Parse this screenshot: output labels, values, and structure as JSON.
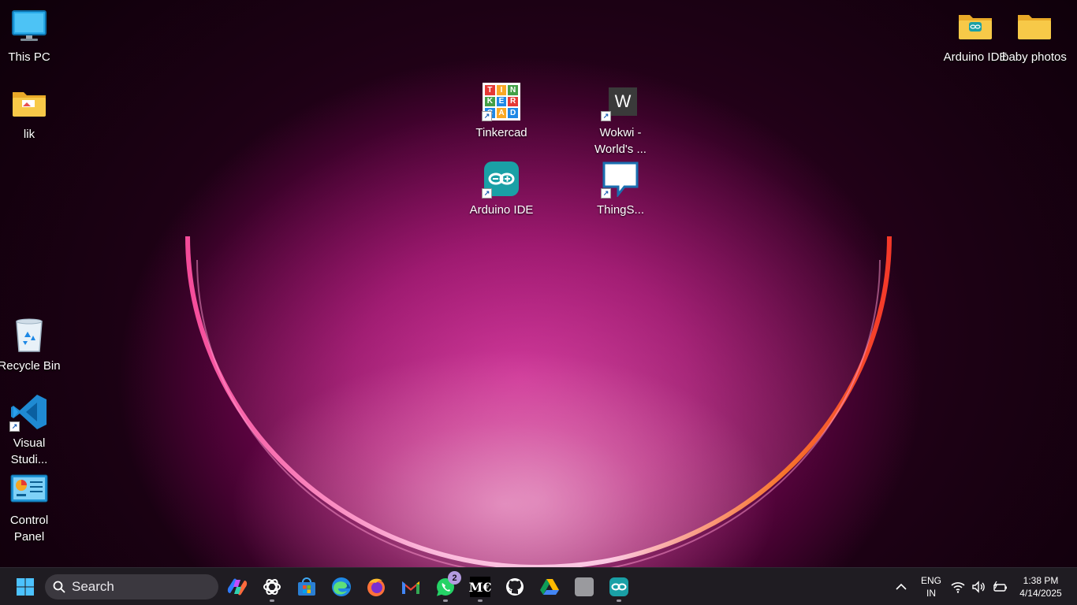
{
  "desktop": {
    "left_icons": [
      {
        "label": "This PC"
      },
      {
        "label": "lik"
      },
      {
        "label": "Recycle Bin"
      },
      {
        "label": "Visual Studi..."
      },
      {
        "label": "Control Panel"
      }
    ],
    "center_icons": [
      {
        "label": "Tinkercad",
        "tile": [
          "T",
          "I",
          "N",
          "K",
          "E",
          "R",
          "C",
          "A",
          "D"
        ]
      },
      {
        "label": "Wokwi - World's ...",
        "glyph": "W"
      },
      {
        "label": "Arduino IDE"
      },
      {
        "label": "ThingS..."
      }
    ],
    "right_icons": [
      {
        "label": "Arduino IDE"
      },
      {
        "label": "baby photos"
      }
    ]
  },
  "taskbar": {
    "search_label": "Search",
    "apps": [
      {
        "icon": "copilot-icon"
      },
      {
        "icon": "chatgpt-icon",
        "running": true
      },
      {
        "icon": "microsoft-store-icon"
      },
      {
        "icon": "edge-icon"
      },
      {
        "icon": "firefox-icon"
      },
      {
        "icon": "gmail-icon"
      },
      {
        "icon": "whatsapp-icon",
        "running": true,
        "badge": "2"
      },
      {
        "icon": "medium-icon",
        "running": true,
        "text": "M€"
      },
      {
        "icon": "github-icon"
      },
      {
        "icon": "google-drive-icon"
      },
      {
        "icon": "blank-app-icon"
      },
      {
        "icon": "arduino-icon",
        "running": true
      }
    ],
    "tray": {
      "lang_line1": "ENG",
      "lang_line2": "IN",
      "time": "1:38 PM",
      "date": "4/14/2025"
    }
  },
  "colors": {
    "accent_blue": "#1e88e5",
    "arduino_teal": "#1aa0a6",
    "taskbar_bg": "#1f1c22"
  }
}
